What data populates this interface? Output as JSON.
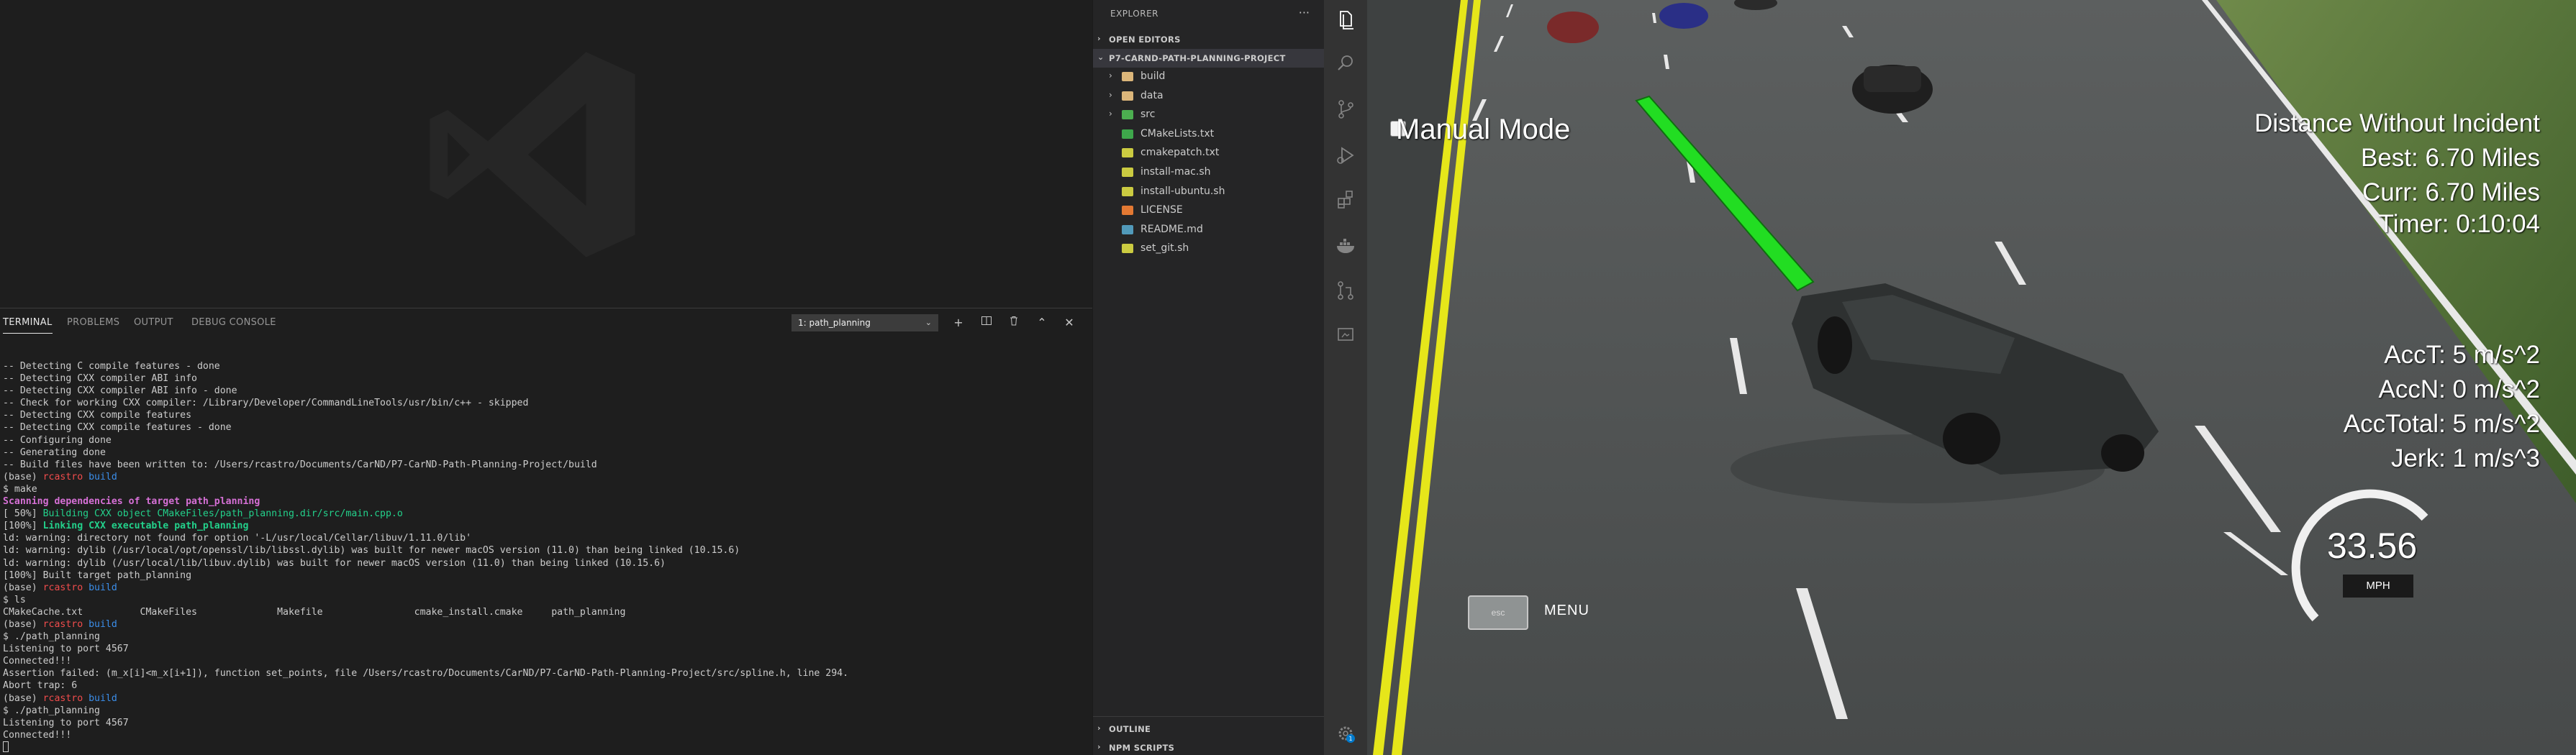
{
  "panel": {
    "tabs": [
      {
        "label": "TERMINAL",
        "active": true
      },
      {
        "label": "PROBLEMS",
        "active": false
      },
      {
        "label": "OUTPUT",
        "active": false
      },
      {
        "label": "DEBUG CONSOLE",
        "active": false
      }
    ],
    "terminal_select": "1: path_planning",
    "icons": [
      "plus-icon",
      "split-icon",
      "trash-icon",
      "chevron-up-icon",
      "close-icon"
    ]
  },
  "terminal": {
    "lines": [
      [
        {
          "t": "-- Detecting C compile features - done"
        }
      ],
      [
        {
          "t": "-- Detecting CXX compiler ABI info"
        }
      ],
      [
        {
          "t": "-- Detecting CXX compiler ABI info - done"
        }
      ],
      [
        {
          "t": "-- Check for working CXX compiler: /Library/Developer/CommandLineTools/usr/bin/c++ - skipped"
        }
      ],
      [
        {
          "t": "-- Detecting CXX compile features"
        }
      ],
      [
        {
          "t": "-- Detecting CXX compile features - done"
        }
      ],
      [
        {
          "t": "-- Configuring done"
        }
      ],
      [
        {
          "t": "-- Generating done"
        }
      ],
      [
        {
          "t": "-- Build files have been written to: /Users/rcastro/Documents/CarND/P7-CarND-Path-Planning-Project/build"
        }
      ],
      [
        {
          "t": "(base) "
        },
        {
          "t": "rcastro",
          "c": "c-red"
        },
        {
          "t": " build",
          "c": "c-blue"
        }
      ],
      [
        {
          "t": "$ make"
        }
      ],
      [
        {
          "t": "Scanning dependencies of target path_planning",
          "c": "c-magenta"
        }
      ],
      [
        {
          "t": "[ 50%] "
        },
        {
          "t": "Building CXX object CMakeFiles/path_planning.dir/src/main.cpp.o",
          "c": "c-green"
        }
      ],
      [
        {
          "t": "[100%] "
        },
        {
          "t": "Linking CXX executable path_planning",
          "c": "c-boldgreen"
        }
      ],
      [
        {
          "t": "ld: warning: directory not found for option '-L/usr/local/Cellar/libuv/1.11.0/lib'"
        }
      ],
      [
        {
          "t": "ld: warning: dylib (/usr/local/opt/openssl/lib/libssl.dylib) was built for newer macOS version (11.0) than being linked (10.15.6)"
        }
      ],
      [
        {
          "t": "ld: warning: dylib (/usr/local/lib/libuv.dylib) was built for newer macOS version (11.0) than being linked (10.15.6)"
        }
      ],
      [
        {
          "t": "[100%] Built target path_planning"
        }
      ],
      [
        {
          "t": "(base) "
        },
        {
          "t": "rcastro",
          "c": "c-red"
        },
        {
          "t": " build",
          "c": "c-blue"
        }
      ],
      [
        {
          "t": "$ ls"
        }
      ],
      [
        {
          "t": "CMakeCache.txt          CMakeFiles              Makefile                cmake_install.cmake     path_planning"
        }
      ],
      [
        {
          "t": "(base) "
        },
        {
          "t": "rcastro",
          "c": "c-red"
        },
        {
          "t": " build",
          "c": "c-blue"
        }
      ],
      [
        {
          "t": "$ ./path_planning"
        }
      ],
      [
        {
          "t": "Listening to port 4567"
        }
      ],
      [
        {
          "t": "Connected!!!"
        }
      ],
      [
        {
          "t": "Assertion failed: (m_x[i]<m_x[i+1]), function set_points, file /Users/rcastro/Documents/CarND/P7-CarND-Path-Planning-Project/src/spline.h, line 294."
        }
      ],
      [
        {
          "t": "Abort trap: 6"
        }
      ],
      [
        {
          "t": "(base) "
        },
        {
          "t": "rcastro",
          "c": "c-red"
        },
        {
          "t": " build",
          "c": "c-blue"
        }
      ],
      [
        {
          "t": "$ ./path_planning"
        }
      ],
      [
        {
          "t": "Listening to port 4567"
        }
      ],
      [
        {
          "t": "Connected!!!"
        }
      ]
    ]
  },
  "explorer": {
    "title": "EXPLORER",
    "open_editors": "OPEN EDITORS",
    "project": "P7-CARND-PATH-PLANNING-PROJECT",
    "items": [
      {
        "label": "build",
        "type": "folder",
        "icon": "folder-icon",
        "color": "#dcb67a"
      },
      {
        "label": "data",
        "type": "folder",
        "icon": "folder-icon",
        "color": "#dcb67a"
      },
      {
        "label": "src",
        "type": "folder",
        "icon": "folder-src-icon",
        "color": "#4caf50"
      },
      {
        "label": "CMakeLists.txt",
        "type": "file",
        "icon": "cmake-icon",
        "color": "#3ea74b"
      },
      {
        "label": "cmakepatch.txt",
        "type": "file",
        "icon": "text-file-icon",
        "color": "#cbcb41"
      },
      {
        "label": "install-mac.sh",
        "type": "file",
        "icon": "shell-file-icon",
        "color": "#cbcb41"
      },
      {
        "label": "install-ubuntu.sh",
        "type": "file",
        "icon": "shell-file-icon",
        "color": "#cbcb41"
      },
      {
        "label": "LICENSE",
        "type": "file",
        "icon": "license-icon",
        "color": "#e37933"
      },
      {
        "label": "README.md",
        "type": "file",
        "icon": "markdown-icon",
        "color": "#519aba"
      },
      {
        "label": "set_git.sh",
        "type": "file",
        "icon": "shell-file-icon",
        "color": "#cbcb41"
      }
    ],
    "outline": "OUTLINE",
    "npm_scripts": "NPM SCRIPTS"
  },
  "activity_bar": {
    "items": [
      "explorer-icon",
      "search-icon",
      "source-control-icon",
      "run-debug-icon",
      "extensions-icon",
      "docker-icon",
      "pull-requests-icon",
      "remote-explorer-icon"
    ],
    "settings_badge": "1"
  },
  "simulator": {
    "manual_mode": "Manual Mode",
    "distance_title": "Distance Without Incident",
    "best": "Best: 6.70 Miles",
    "curr": "Curr: 6.70 Miles",
    "timer": "Timer: 0:10:04",
    "acc_t": "AccT: 5 m/s^2",
    "acc_n": "AccN: 0 m/s^2",
    "acc_total": "AccTotal: 5 m/s^2",
    "jerk": "Jerk: 1 m/s^3",
    "speed": "33.56",
    "speed_unit": "MPH",
    "esc": "esc",
    "menu": "MENU",
    "colors": {
      "road": "#4d5050",
      "grass": "#4a6b32",
      "lane_yellow": "#e6e61a",
      "path_green": "#22dd22"
    }
  }
}
